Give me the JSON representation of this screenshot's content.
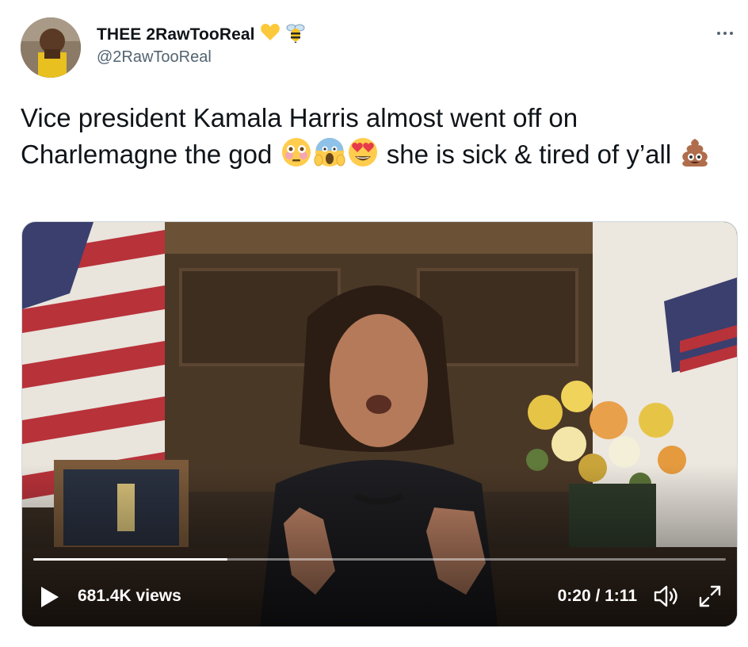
{
  "tweet": {
    "display_name": "THEE 2RawTooReal",
    "name_emojis": [
      "yellow-heart",
      "bee"
    ],
    "handle": "@2RawTooReal",
    "text_part1": "Vice president Kamala Harris almost went off on Charlemagne the god ",
    "text_part2": " she is sick & tired of y’all ",
    "inline_emojis_1": [
      "flushed-face",
      "screaming-face",
      "heart-eyes-face"
    ],
    "inline_emojis_2": [
      "pile-of-poo"
    ]
  },
  "video": {
    "views": "681.4K views",
    "time": "0:20 / 1:11",
    "progress": 0.28,
    "controls": {
      "play_icon": "play-icon",
      "volume_icon": "volume-icon",
      "fullscreen_icon": "fullscreen-icon"
    }
  },
  "colors": {
    "text": "#0f1419",
    "secondary": "#536471",
    "border": "#cfd9de"
  }
}
